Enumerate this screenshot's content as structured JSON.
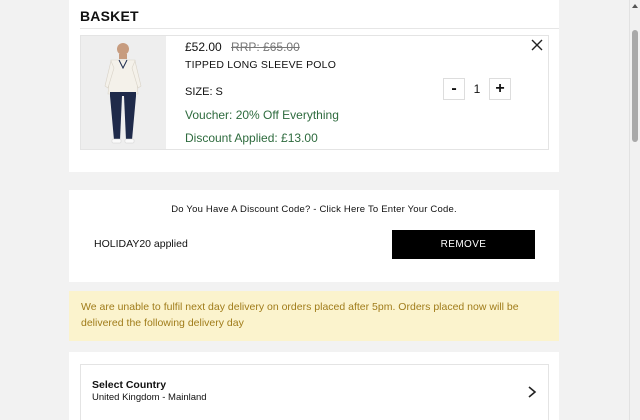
{
  "basket": {
    "title": "BASKET",
    "item": {
      "price": "£52.00",
      "rrp": "RRP: £65.00",
      "name": "TIPPED LONG SLEEVE POLO",
      "size": "SIZE: S",
      "voucher": "Voucher: 20% Off Everything",
      "discount": "Discount Applied: £13.00",
      "quantity": "1",
      "minus_label": "-",
      "plus_label": "+",
      "image_icon": "product-photo"
    }
  },
  "discount_code": {
    "prompt": "Do You Have A Discount Code? - Click Here To Enter Your Code.",
    "applied": "HOLIDAY20 applied",
    "remove_label": "REMOVE"
  },
  "notice": {
    "text": "We are unable to fulfil next day delivery on orders placed after 5pm. Orders placed now will be delivered the following delivery day"
  },
  "country": {
    "label": "Select Country",
    "value": "United Kingdom - Mainland"
  },
  "colors": {
    "accent_green": "#2e6b3e",
    "notice_bg": "#fbf3cd",
    "notice_text": "#a07c1a",
    "button_bg": "#000000"
  }
}
